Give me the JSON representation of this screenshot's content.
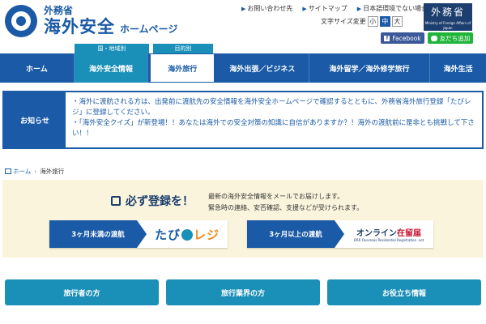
{
  "header": {
    "ministry": "外務省",
    "title": "海外安全",
    "subtitle": "ホームページ",
    "top_links": [
      "お問い合わせ先",
      "サイトマップ",
      "日本語環境でない場合"
    ],
    "font_size_label": "文字サイズ変更",
    "font_sizes": [
      "小",
      "中",
      "大"
    ],
    "mofa_badge": "外務省",
    "mofa_badge_sub": "Ministry of Foreign Affairs of Japan",
    "facebook": "Facebook",
    "line": "友だち追加"
  },
  "nav": {
    "tag_region": "国・地域別",
    "tag_purpose": "目的別",
    "items": [
      "ホーム",
      "海外安全情報",
      "海外旅行",
      "海外出張／ビジネス",
      "海外留学／海外修学旅行",
      "海外生活"
    ]
  },
  "notice": {
    "label": "お知らせ",
    "line1": "・海外に渡航される方は、出発前に渡航先の安全情報を海外安全ホームページで確認するとともに、外務省海外旅行登録「たびレジ」に登録してください。",
    "line2": "・「海外安全クイズ」が新登場！！あなたは海外での安全対策の知識に自信がありますか？！海外の渡航前に是非とも挑戦して下さい！！"
  },
  "breadcrumb": {
    "home": "ホーム",
    "current": "海外旅行"
  },
  "register": {
    "heading": "必ず登録を！",
    "desc1": "最新の海外安全情報をメールでお届けします。",
    "desc2": "緊急時の連絡、安否確認、支援などが受けられます。",
    "btn1_label": "3ヶ月未満の渡航",
    "btn1_logo_a": "たび",
    "btn1_logo_b": "レジ",
    "btn2_label": "3ヶ月以上の渡航",
    "btn2_logo_a": "オンライン",
    "btn2_logo_b": "在留届",
    "btn2_logo_sub": "ORR Overseas Residential Registration .net"
  },
  "bottom": {
    "btn1": "旅行者の方",
    "btn2": "旅行業界の方",
    "btn3": "お役立ち情報"
  },
  "colors": {
    "primary": "#1a5aa6",
    "accent": "#1a8fb8",
    "register_bg": "#fbf4dc",
    "badge": "#1d3f6f"
  }
}
